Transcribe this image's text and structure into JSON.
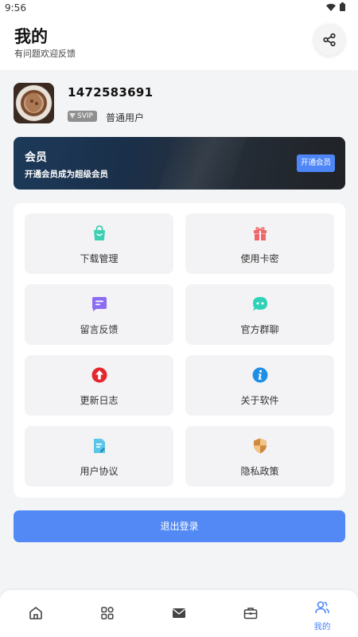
{
  "status_bar": {
    "time": "9:56"
  },
  "header": {
    "title": "我的",
    "subtitle": "有问题欢迎反馈"
  },
  "profile": {
    "username": "1472583691",
    "badge": "SVIP",
    "level": "普通用户"
  },
  "vip": {
    "title": "会员",
    "description": "开通会员成为超级会员",
    "button": "开通会员"
  },
  "grid": {
    "items": [
      {
        "label": "下载管理",
        "icon": "shopping-bag-icon",
        "color": "#3ecfb2"
      },
      {
        "label": "使用卡密",
        "icon": "gift-icon",
        "color": "#f0676b"
      },
      {
        "label": "留言反馈",
        "icon": "message-icon",
        "color": "#8b6cf2"
      },
      {
        "label": "官方群聊",
        "icon": "chat-bubble-icon",
        "color": "#2fd1b8"
      },
      {
        "label": "更新日志",
        "icon": "upload-arrow-icon",
        "color": "#e5262d"
      },
      {
        "label": "关于软件",
        "icon": "info-icon",
        "color": "#1f8fe6"
      },
      {
        "label": "用户协议",
        "icon": "document-icon",
        "color": "#5cc6e8"
      },
      {
        "label": "隐私政策",
        "icon": "shield-icon",
        "color": "#d08a3c"
      }
    ]
  },
  "logout": {
    "label": "退出登录"
  },
  "bottom_nav": {
    "items": [
      {
        "name": "home",
        "icon": "home-icon"
      },
      {
        "name": "apps",
        "icon": "grid-icon"
      },
      {
        "name": "messages",
        "icon": "mail-icon"
      },
      {
        "name": "toolbox",
        "icon": "toolbox-icon"
      },
      {
        "name": "mine",
        "icon": "user-icon",
        "label": "我的",
        "active": true
      }
    ]
  },
  "colors": {
    "accent": "#4f86f7",
    "logout": "#5289f4",
    "background": "#f3f4f6"
  }
}
